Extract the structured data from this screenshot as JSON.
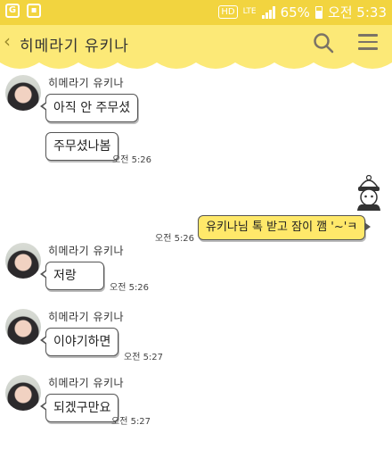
{
  "status_bar": {
    "hd": "HD",
    "network": "LTE",
    "battery": "65%",
    "time": "오전 5:33"
  },
  "header": {
    "back_icon": "chevron-left-icon",
    "title": "히메라기 유키나",
    "search_icon": "search-icon",
    "menu_icon": "menu-icon"
  },
  "messages": [
    {
      "sender": "히메라기 유키나",
      "text": "아직 안 주무셨",
      "time": ""
    },
    {
      "sender": "",
      "text": "주무셨나봄",
      "time": "오전 5:26"
    },
    {
      "sender": "me",
      "text": "유키나님 톡 받고 잠이 깸 '~'ㅋ",
      "time": "오전 5:26"
    },
    {
      "sender": "히메라기 유키나",
      "text": "저랑",
      "time": "오전 5:26"
    },
    {
      "sender": "히메라기 유키나",
      "text": "이야기하면",
      "time": "오전 5:27"
    },
    {
      "sender": "히메라기 유키나",
      "text": "되겠구만요",
      "time": "오전 5:27"
    }
  ]
}
